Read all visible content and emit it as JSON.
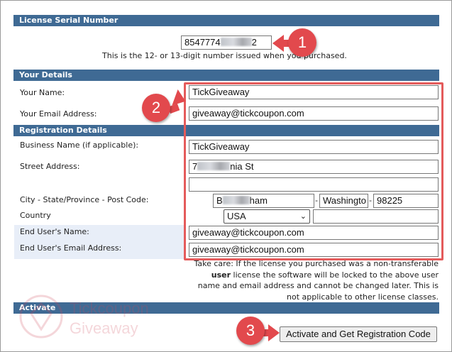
{
  "license": {
    "header": "License Serial Number",
    "serial_prefix": "8547774",
    "serial_suffix": "2",
    "hint": "This is the 12- or 13-digit number issued when you purchased."
  },
  "details": {
    "header": "Your Details",
    "name_label": "Your Name:",
    "name_value": "TickGiveaway",
    "email_label": "Your Email Address:",
    "email_value": "giveaway@tickcoupon.com"
  },
  "registration": {
    "header": "Registration Details",
    "business_label": "Business Name (if applicable):",
    "business_value": "TickGiveaway",
    "street_label": "Street Address:",
    "street_prefix": "7",
    "street_suffix": "nia St",
    "street2_value": "",
    "city_label": "City - State/Province - Post Code:",
    "city_prefix": "B",
    "city_suffix": "ham",
    "state_value": "Washingto",
    "postcode_value": "98225",
    "dash": "-",
    "country_label": "Country",
    "country_value": "USA",
    "country_extra": "",
    "end_user_name_label": "End User's Name:",
    "end_user_name_value": "giveaway@tickcoupon.com",
    "end_user_email_label": "End User's Email Address:",
    "end_user_email_value": "giveaway@tickcoupon.com",
    "note_line1": "Take care: If the license you purchased was a non-transferable",
    "note_bold": "user",
    "note_line2_rest": " license the software will be locked to the above user",
    "note_line3": "name and email address and cannot be changed later. This is",
    "note_line4": "not applicable to other license classes."
  },
  "activate": {
    "header": "Activate",
    "button_label": "Activate and Get Registration Code"
  },
  "badges": [
    "1",
    "2",
    "3"
  ],
  "watermark": {
    "line1": "Tickcoupon",
    "line2": "Giveaway"
  },
  "colors": {
    "header_bg": "#3f6a94",
    "highlight": "#e45b5b",
    "badge": "#e2494d",
    "end_user_bg": "#e8eef8"
  }
}
